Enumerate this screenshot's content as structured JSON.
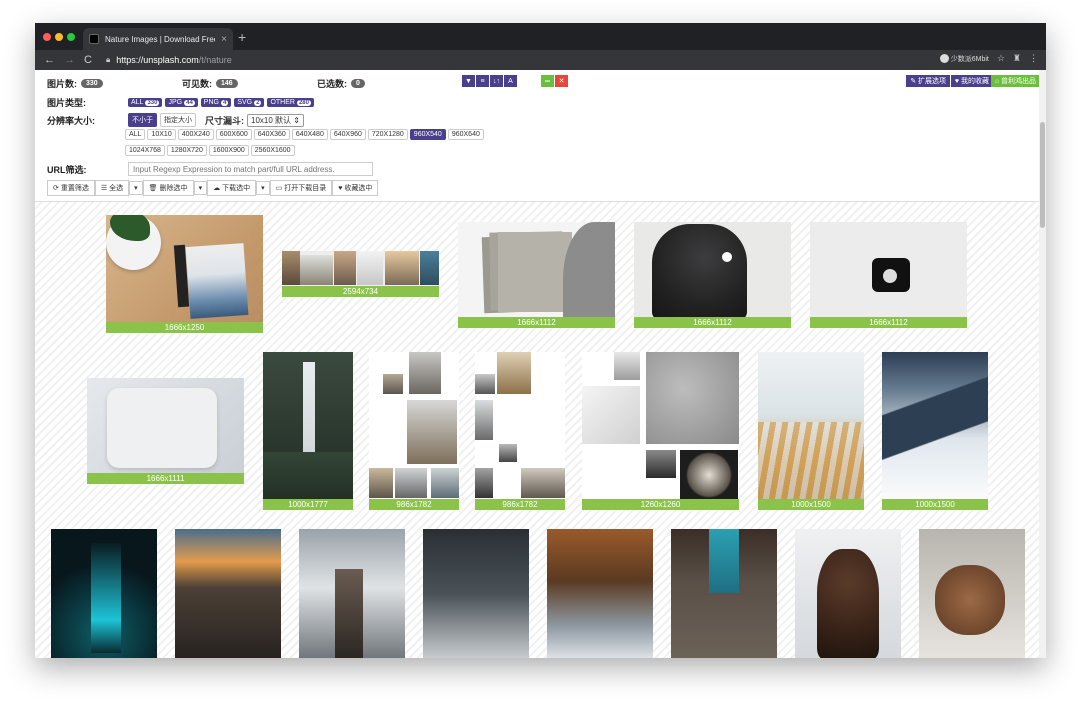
{
  "browser": {
    "tab_title": "Nature Images | Download Free",
    "tab_close": "×",
    "new_tab": "+",
    "url_host": "https://unsplash.com",
    "url_path": "/t/nature",
    "ext_chip": "少数派6Mbit"
  },
  "toolbar": {
    "total_label": "图片数:",
    "total_value": "330",
    "visible_label": "可见数:",
    "visible_value": "146",
    "selected_label": "已选数:",
    "selected_value": "0",
    "ext_options": "扩展选项",
    "favorites": "我的收藏",
    "products": "曾利鸿出品"
  },
  "filters": {
    "type_label": "图片类型:",
    "types": [
      {
        "label": "ALL",
        "count": "330"
      },
      {
        "label": "JPG",
        "count": "44"
      },
      {
        "label": "PNG",
        "count": "4"
      },
      {
        "label": "SVG",
        "count": "2"
      },
      {
        "label": "OTHER",
        "count": "280"
      }
    ],
    "resolution_label": "分辨率大小:",
    "res_mode_active": "不小于",
    "res_mode_other": "指定大小",
    "funnel_label": "尺寸漏斗:",
    "funnel_value": "10x10 默认",
    "sizes_row1": [
      "ALL",
      "10X10",
      "400X240",
      "600X600",
      "640X360",
      "640X480",
      "640X960",
      "720X1280",
      "960X540",
      "960X640"
    ],
    "sizes_row2": [
      "1024X768",
      "1280X720",
      "1600X900",
      "2560X1600"
    ],
    "active_size": "960X540",
    "url_label": "URL筛选:",
    "url_placeholder": "Input Regexp Expression to match part/full URL address."
  },
  "actions": {
    "reset": "重置筛选",
    "select_all": "全选",
    "delete": "删除选中",
    "download": "下载选中",
    "open_dir": "打开下载目录",
    "collect": "收藏选中"
  },
  "gallery": {
    "dims": [
      "1666x1250",
      "2594x734",
      "1666x1112",
      "1666x1112",
      "1666x1112",
      "1666x1111",
      "1000x1777",
      "986x1782",
      "986x1782",
      "1260x1260",
      "1000x1500",
      "1000x1500"
    ]
  },
  "colors": {
    "accent": "#4a3f8c",
    "badge_green": "#8bc34a",
    "danger": "#e5483b"
  }
}
